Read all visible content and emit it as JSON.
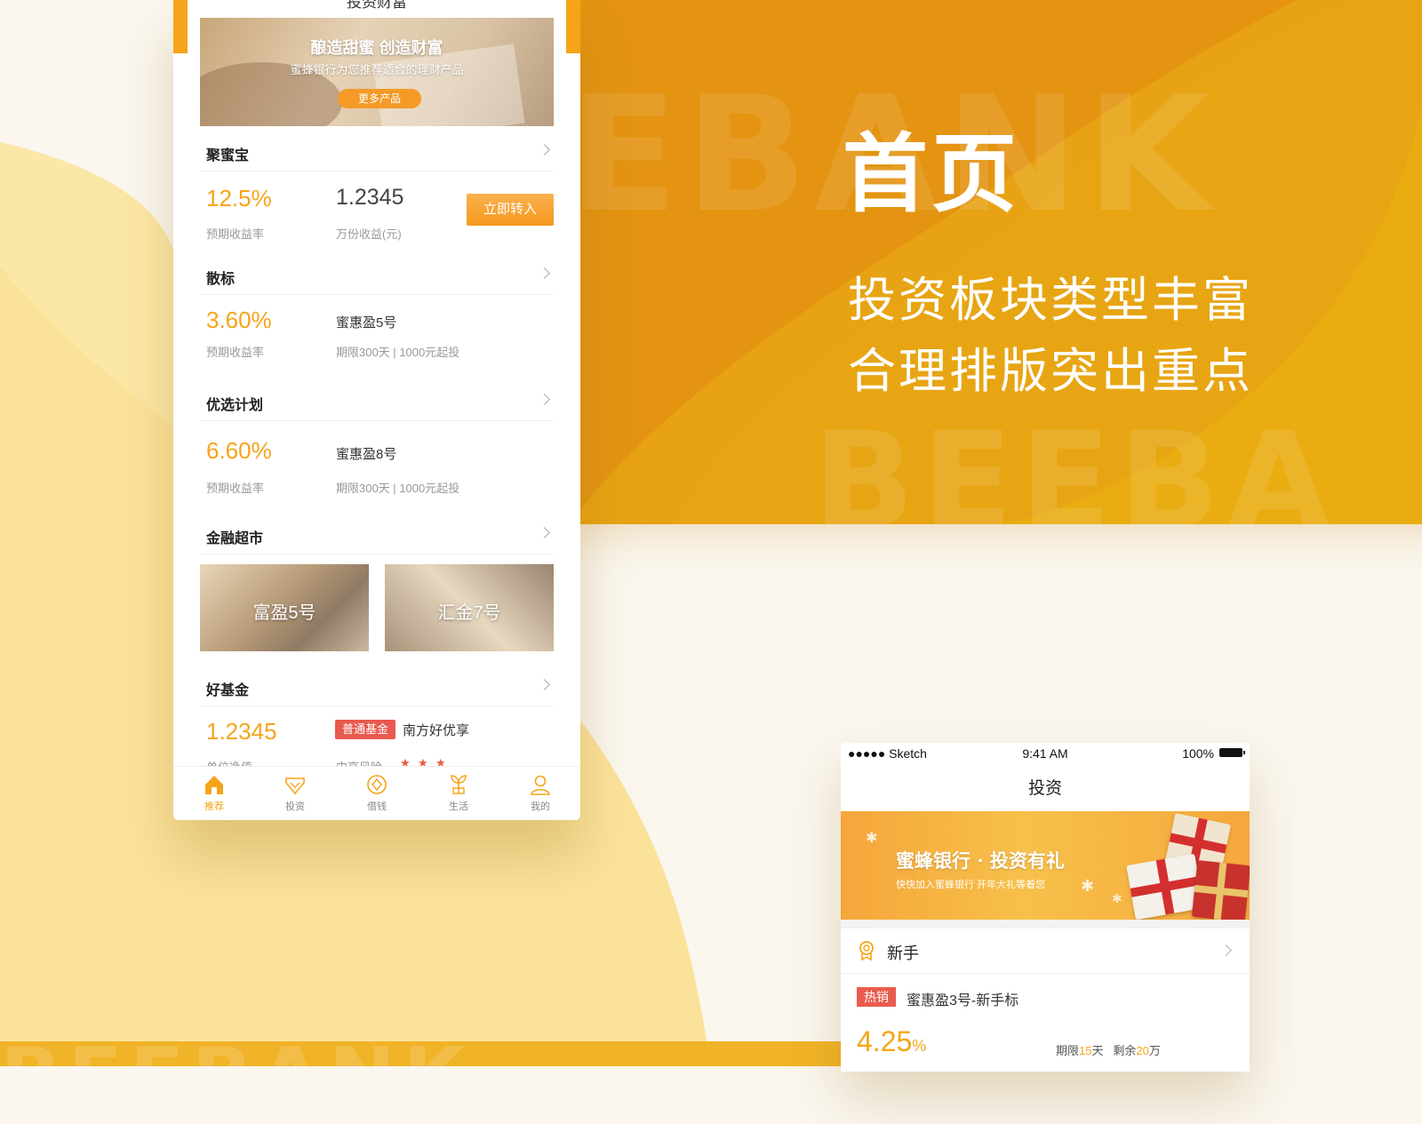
{
  "hero": {
    "title": "首页",
    "line1": "投资板块类型丰富",
    "line2": "合理排版突出重点",
    "watermark1": "EBANK",
    "watermark2": "BEEBA",
    "watermark3": "BEEBANK"
  },
  "colors": {
    "accent": "#f6a419",
    "orange_bg": "#e9960f",
    "yellow": "#fbe7a6",
    "tag_red": "#e85a4f"
  },
  "phone1": {
    "nav_title": "投资财富",
    "banner": {
      "title": "酿造甜蜜 创造财富",
      "subtitle": "蜜蜂银行为您推荐适合的理财产品",
      "button": "更多产品"
    },
    "jumibao": {
      "header": "聚蜜宝",
      "rate": "12.5%",
      "rate_label": "预期收益率",
      "income": "1.2345",
      "income_label": "万份收益(元)",
      "button": "立即转入"
    },
    "sanbiao": {
      "header": "散标",
      "rate": "3.60%",
      "rate_label": "预期收益率",
      "name": "蜜惠盈5号",
      "desc": "期限300天 | 1000元起投"
    },
    "youxuan": {
      "header": "优选计划",
      "rate": "6.60%",
      "rate_label": "预期收益率",
      "name": "蜜惠盈8号",
      "desc": "期限300天 | 1000元起投"
    },
    "market": {
      "header": "金融超市",
      "tiles": [
        "富盈5号",
        "汇金7号"
      ]
    },
    "fund": {
      "header": "好基金",
      "nav": "1.2345",
      "nav_label": "单位净值",
      "tag": "普通基金",
      "name": "南方好优享",
      "risk": "中高风险",
      "stars": 3
    },
    "tabs": [
      {
        "label": "推荐",
        "icon": "home-icon"
      },
      {
        "label": "投资",
        "icon": "diamond-icon"
      },
      {
        "label": "借钱",
        "icon": "coin-icon"
      },
      {
        "label": "生活",
        "icon": "sprout-icon"
      },
      {
        "label": "我的",
        "icon": "user-icon"
      }
    ]
  },
  "phone2": {
    "status": {
      "carrier": "●●●●● Sketch",
      "time": "9:41 AM",
      "battery": "100%"
    },
    "title": "投资",
    "banner": {
      "title": "蜜蜂银行 · 投资有礼",
      "subtitle": "快快加入蜜蜂银行 开年大礼等着您"
    },
    "section": "新手",
    "hot_tag": "热销",
    "product": "蜜惠盈3号-新手标",
    "rate_value": "4.25",
    "rate_unit": "%",
    "term_prefix": "期限",
    "term_value": "15",
    "term_unit": "天",
    "remain_prefix": "剩余",
    "remain_value": "20",
    "remain_unit": "万"
  }
}
